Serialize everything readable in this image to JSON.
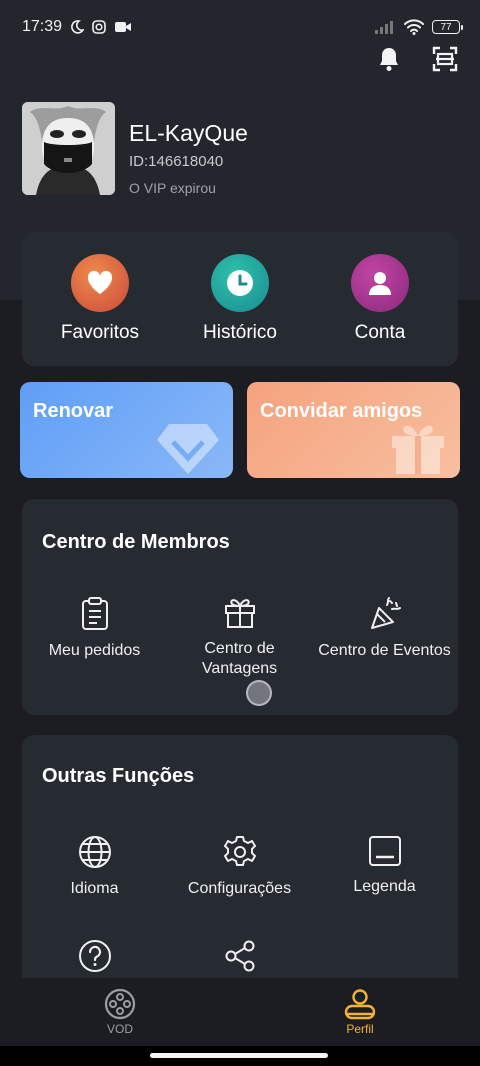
{
  "status_bar": {
    "time": "17:39",
    "battery": "77"
  },
  "profile": {
    "username": "EL-KayQue",
    "user_id": "ID:146618040",
    "vip_status": "O VIP expirou"
  },
  "quick_actions": [
    {
      "label": "Favoritos",
      "icon": "heart-icon",
      "color": "#e2693d"
    },
    {
      "label": "Histórico",
      "icon": "clock-icon",
      "color": "#1fa59a"
    },
    {
      "label": "Conta",
      "icon": "user-icon",
      "color": "#a8338f"
    }
  ],
  "banners": {
    "renew": {
      "label": "Renovar",
      "icon": "diamond-icon"
    },
    "invite": {
      "label": "Convidar amigos",
      "icon": "gift-icon"
    }
  },
  "members_center": {
    "title": "Centro de Membros",
    "items": [
      {
        "label": "Meu pedidos",
        "icon": "clipboard-icon"
      },
      {
        "label": "Centro de Vantagens",
        "icon": "gift-icon"
      },
      {
        "label": "Centro de Eventos",
        "icon": "party-popper-icon"
      }
    ]
  },
  "other_functions": {
    "title": "Outras Funções",
    "items": [
      {
        "label": "Idioma",
        "icon": "globe-icon"
      },
      {
        "label": "Configurações",
        "icon": "gear-icon"
      },
      {
        "label": "Legenda",
        "icon": "subtitle-icon"
      },
      {
        "label": "",
        "icon": "help-icon"
      },
      {
        "label": "",
        "icon": "share-icon"
      }
    ]
  },
  "bottom_nav": [
    {
      "label": "VOD",
      "icon": "film-reel-icon",
      "active": false
    },
    {
      "label": "Perfil",
      "icon": "profile-icon",
      "active": true
    }
  ],
  "colors": {
    "accent": "#f2b233",
    "background": "#1b1d22",
    "card": "#262a31"
  }
}
